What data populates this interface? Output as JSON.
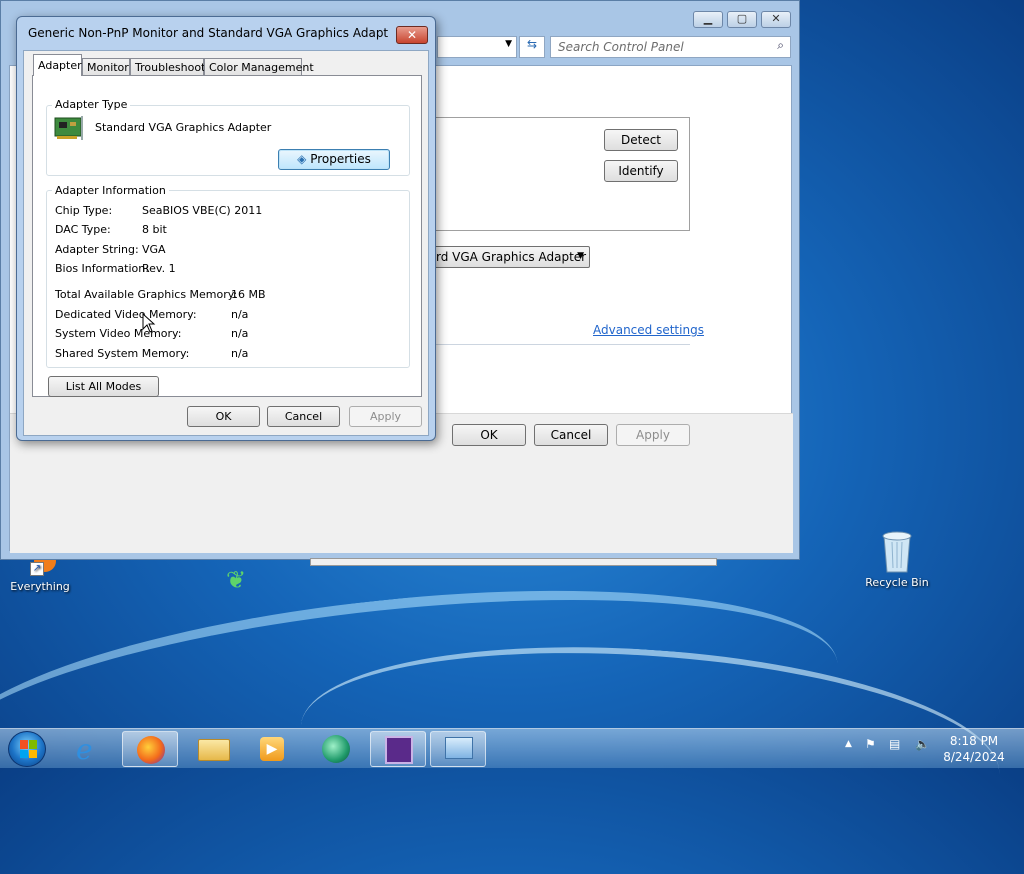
{
  "back_window": {
    "search_placeholder": "Search Control Panel",
    "detect_label": "Detect",
    "identify_label": "Identify",
    "display_select_value": "rd VGA Graphics Adapter",
    "advanced_settings_link": "Advanced settings",
    "ok_label": "OK",
    "cancel_label": "Cancel",
    "apply_label": "Apply"
  },
  "dialog": {
    "title": "Generic Non-PnP Monitor and Standard VGA Graphics Adapter Pro...",
    "close_glyph": "✕",
    "tabs": [
      {
        "label": "Adapter",
        "active": true
      },
      {
        "label": "Monitor",
        "active": false
      },
      {
        "label": "Troubleshoot",
        "active": false
      },
      {
        "label": "Color Management",
        "active": false
      }
    ],
    "adapter_type": {
      "group_label": "Adapter Type",
      "name": "Standard VGA Graphics Adapter",
      "properties_label": "Properties"
    },
    "adapter_info": {
      "group_label": "Adapter Information",
      "rows": [
        {
          "label": "Chip Type:",
          "value": "SeaBIOS VBE(C) 2011"
        },
        {
          "label": "DAC Type:",
          "value": "8 bit"
        },
        {
          "label": "Adapter String:",
          "value": "VGA"
        },
        {
          "label": "Bios Information:",
          "value": "Rev. 1"
        }
      ],
      "memory_rows": [
        {
          "label": "Total Available Graphics Memory:",
          "value": "16 MB"
        },
        {
          "label": "Dedicated Video Memory:",
          "value": "n/a"
        },
        {
          "label": "System Video Memory:",
          "value": "n/a"
        },
        {
          "label": "Shared System Memory:",
          "value": "n/a"
        }
      ]
    },
    "list_all_modes_label": "List All Modes",
    "ok_label": "OK",
    "cancel_label": "Cancel",
    "apply_label": "Apply"
  },
  "desktop": {
    "icons": [
      {
        "label": "Everything"
      },
      {
        "label": "Recycle Bin"
      }
    ]
  },
  "taskbar": {
    "apps": [
      "internet-explorer",
      "firefox",
      "file-explorer",
      "media-player",
      "app-circle",
      "app-chip",
      "control-panel"
    ],
    "clock_time": "8:18 PM",
    "clock_date": "8/24/2024"
  }
}
